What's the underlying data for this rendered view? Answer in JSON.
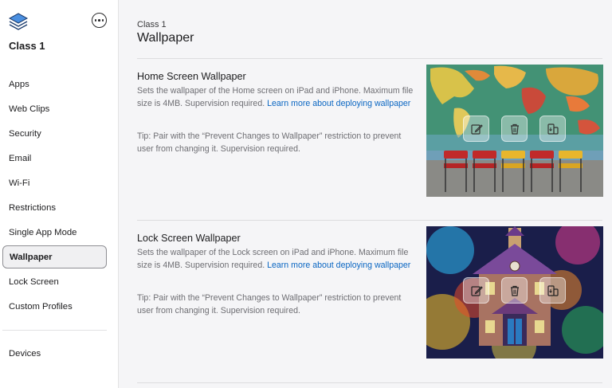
{
  "sidebar": {
    "class_name": "Class 1",
    "items": [
      {
        "label": "Apps"
      },
      {
        "label": "Web Clips"
      },
      {
        "label": "Security"
      },
      {
        "label": "Email"
      },
      {
        "label": "Wi-Fi"
      },
      {
        "label": "Restrictions"
      },
      {
        "label": "Single App Mode"
      },
      {
        "label": "Wallpaper",
        "active": true
      },
      {
        "label": "Lock Screen"
      },
      {
        "label": "Custom Profiles"
      }
    ],
    "devices_label": "Devices",
    "icons": {
      "app": "stack-layers-icon",
      "more": "ellipsis-circle-icon"
    }
  },
  "header": {
    "breadcrumb": "Class 1",
    "title": "Wallpaper"
  },
  "sections": [
    {
      "title": "Home Screen Wallpaper",
      "desc": "Sets the wallpaper of the Home screen on iPad and iPhone. Maximum file size is 4MB. Supervision required.",
      "link": "Learn more about deploying wallpaper",
      "tip": "Tip: Pair with the “Prevent Changes to Wallpaper” restriction to prevent user from changing it. Supervision required.",
      "image": "classroom-map-chairs"
    },
    {
      "title": "Lock Screen Wallpaper",
      "desc": "Sets the wallpaper of the Lock screen on iPad and iPhone. Maximum file size is 4MB. Supervision required.",
      "link": "Learn more about deploying wallpaper",
      "tip": "Tip: Pair with the “Prevent Changes to Wallpaper” restriction to prevent user from changing it. Supervision required.",
      "image": "painted-schoolhouse"
    }
  ],
  "image_actions": [
    "edit-icon",
    "trash-icon",
    "swap-screens-icon"
  ],
  "colors": {
    "link": "#0a66c2",
    "active_border": "#8e8e93"
  }
}
